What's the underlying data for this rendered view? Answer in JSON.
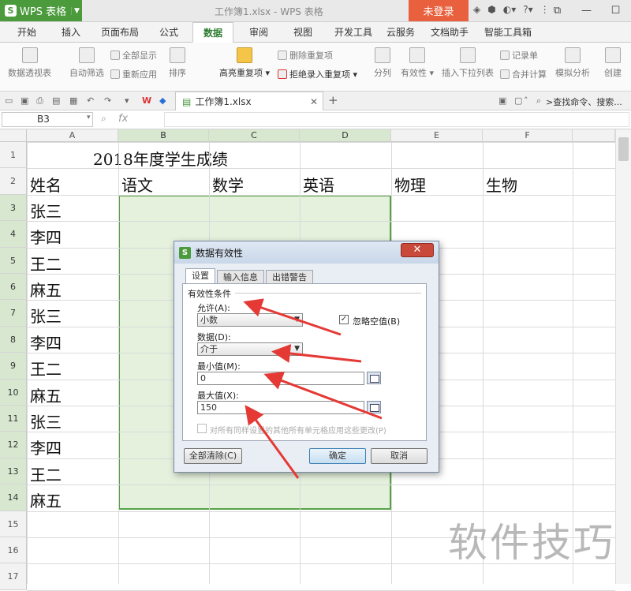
{
  "app": {
    "name": "WPS 表格",
    "doc_title": "工作簿1.xlsx - WPS 表格",
    "login": "未登录"
  },
  "menu": [
    "开始",
    "插入",
    "页面布局",
    "公式",
    "数据",
    "审阅",
    "视图",
    "开发工具",
    "云服务",
    "文档助手",
    "智能工具箱"
  ],
  "menu_active_index": 4,
  "ribbon": {
    "pivot": "数据透视表",
    "autofilter": "自动筛选",
    "show_all": "全部显示",
    "reapply": "重新应用",
    "sort": "排序",
    "highlight_dup": "高亮重复项",
    "remove_dup": "删除重复项",
    "reject_dup": "拒绝录入重复项",
    "split": "分列",
    "validity": "有效性",
    "dropdown": "插入下拉列表",
    "record": "记录单",
    "consolidate": "合并计算",
    "simulate": "模拟分析",
    "create": "创建"
  },
  "quickbar": {
    "file_tab": "工作簿1.xlsx",
    "search": ">查找命令、搜索..."
  },
  "formula_bar": {
    "name_box": "B3",
    "fx": "fx"
  },
  "columns": [
    "A",
    "B",
    "C",
    "D",
    "E",
    "F"
  ],
  "rows": [
    "1",
    "2",
    "3",
    "4",
    "5",
    "6",
    "7",
    "8",
    "9",
    "10",
    "11",
    "12",
    "13",
    "14",
    "15",
    "16",
    "17"
  ],
  "sheet": {
    "title": "2018年度学生成绩",
    "headers": [
      "姓名",
      "语文",
      "数学",
      "英语",
      "物理",
      "生物"
    ],
    "names": [
      "张三",
      "李四",
      "王二",
      "麻五",
      "张三",
      "李四",
      "王二",
      "麻五",
      "张三",
      "李四",
      "王二",
      "麻五"
    ]
  },
  "dialog": {
    "title": "数据有效性",
    "close": "✕",
    "tabs": [
      "设置",
      "输入信息",
      "出错警告"
    ],
    "section": "有效性条件",
    "allow_label": "允许(A):",
    "allow_value": "小数",
    "ignore_blank": "忽略空值(B)",
    "data_label": "数据(D):",
    "data_value": "介于",
    "min_label": "最小值(M):",
    "min_value": "0",
    "max_label": "最大值(X):",
    "max_value": "150",
    "apply_all": "对所有同样设置的其他所有单元格应用这些更改(P)",
    "clear_all": "全部清除(C)",
    "ok": "确定",
    "cancel": "取消"
  },
  "watermark": "软件技巧",
  "colors": {
    "brand": "#4b9a3c",
    "login": "#e8603e",
    "arrow": "#e53935",
    "selection": "#56a447"
  }
}
